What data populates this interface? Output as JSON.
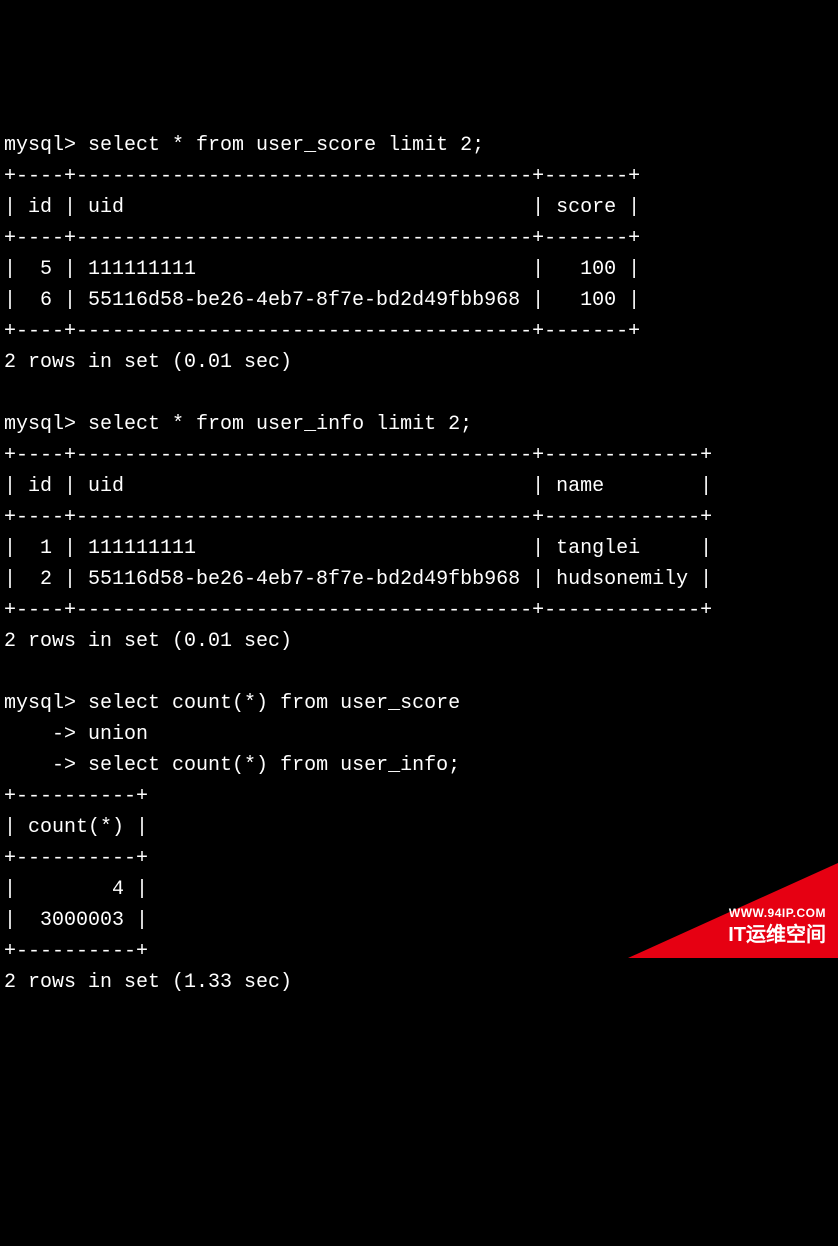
{
  "prompt": "mysql>",
  "continuation": "    ->",
  "queries": {
    "q1": {
      "sql": "select * from user_score limit 2;",
      "border": "+----+--------------------------------------+-------+",
      "header": "| id | uid                                  | score |",
      "rows": [
        "|  5 | 111111111                            |   100 |",
        "|  6 | 55116d58-be26-4eb7-8f7e-bd2d49fbb968 |   100 |"
      ],
      "status": "2 rows in set (0.01 sec)"
    },
    "q2": {
      "sql": "select * from user_info limit 2;",
      "border": "+----+--------------------------------------+-------------+",
      "header": "| id | uid                                  | name        |",
      "rows": [
        "|  1 | 111111111                            | tanglei     |",
        "|  2 | 55116d58-be26-4eb7-8f7e-bd2d49fbb968 | hudsonemily |"
      ],
      "status": "2 rows in set (0.01 sec)"
    },
    "q3": {
      "sql_line1": "select count(*) from user_score",
      "sql_line2": "union",
      "sql_line3": "select count(*) from user_info;",
      "border": "+----------+",
      "header": "| count(*) |",
      "rows": [
        "|        4 |",
        "|  3000003 |"
      ],
      "status": "2 rows in set (1.33 sec)"
    }
  },
  "watermark": {
    "url": "WWW.94IP.COM",
    "brand": "IT运维空间"
  }
}
